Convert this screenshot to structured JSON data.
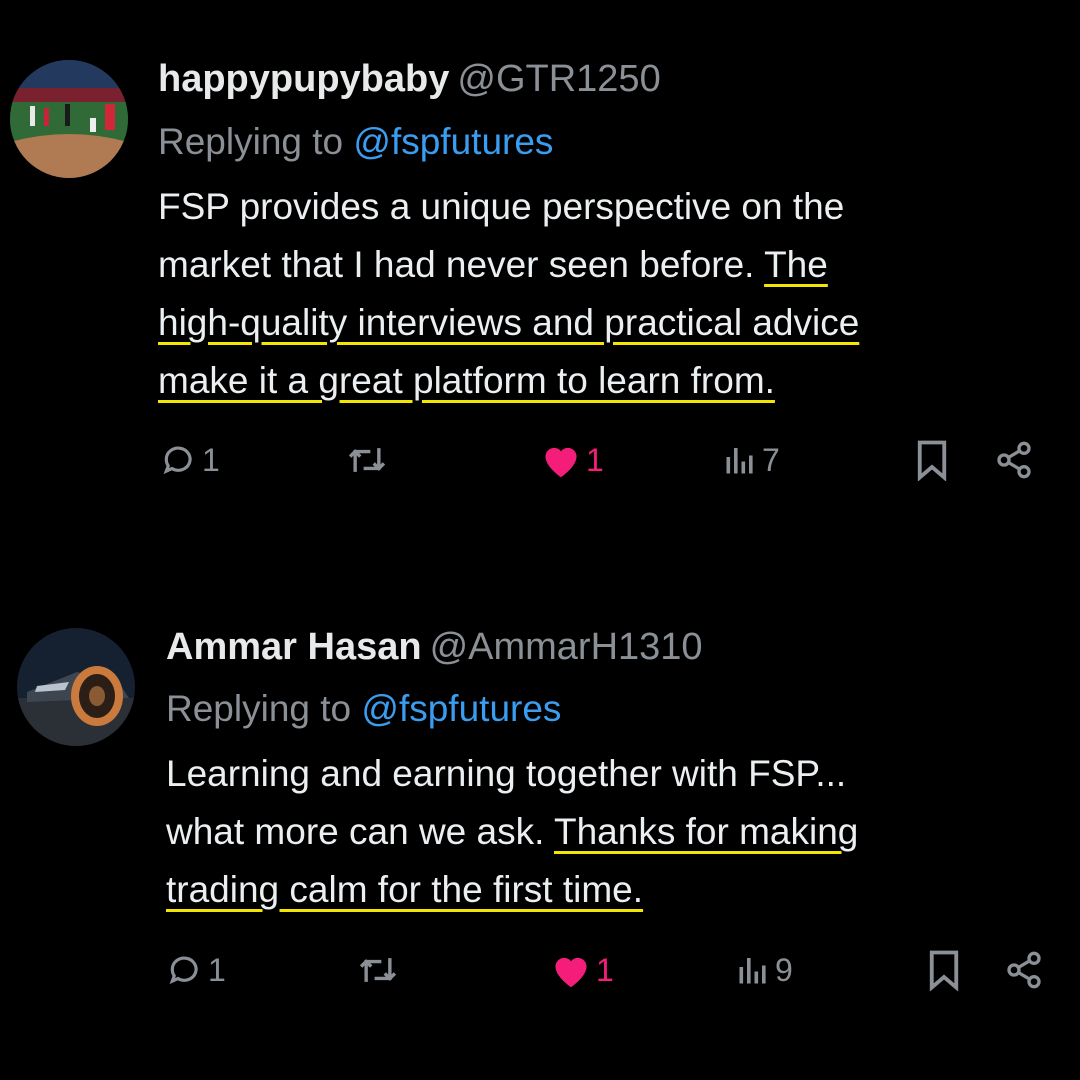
{
  "colors": {
    "background": "#000000",
    "text": "#e7e9ea",
    "muted": "#8b9096",
    "mention": "#3b9df0",
    "like": "#f51d7a",
    "highlight": "#f3e600"
  },
  "tweets": [
    {
      "display_name": "happypupybaby",
      "handle": "@GTR1250",
      "reply_prefix": "Replying to",
      "reply_to": "@fspfutures",
      "lines": [
        {
          "plain": "FSP provides a unique perspective on the",
          "highlight": ""
        },
        {
          "plain": "market that I had never seen before. ",
          "highlight": "The"
        },
        {
          "plain": "",
          "highlight": "high-quality interviews and practical advice"
        },
        {
          "plain": "",
          "highlight": "make it a great platform to learn from."
        }
      ],
      "actions": {
        "replies": "1",
        "retweets": "",
        "likes": "1",
        "views": "7"
      },
      "icons": [
        "reply-icon",
        "retweet-icon",
        "heart-icon",
        "views-icon",
        "bookmark-icon",
        "share-icon"
      ]
    },
    {
      "display_name": "Ammar Hasan",
      "handle": "@AmmarH1310",
      "reply_prefix": "Replying to",
      "reply_to": "@fspfutures",
      "lines": [
        {
          "plain": "Learning and earning together with FSP...",
          "highlight": ""
        },
        {
          "plain": "what more can we ask. ",
          "highlight": "Thanks for making"
        },
        {
          "plain": "",
          "highlight": "trading calm for the first time."
        }
      ],
      "actions": {
        "replies": "1",
        "retweets": "",
        "likes": "1",
        "views": "9"
      },
      "icons": [
        "reply-icon",
        "retweet-icon",
        "heart-icon",
        "views-icon",
        "bookmark-icon",
        "share-icon"
      ]
    }
  ]
}
